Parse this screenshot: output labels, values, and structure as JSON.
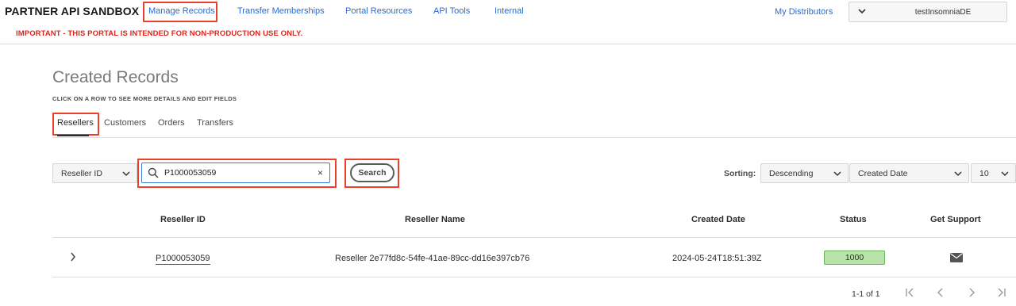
{
  "app": {
    "brand": "PARTNER API SANDBOX",
    "warning": "IMPORTANT - THIS PORTAL IS INTENDED FOR NON-PRODUCTION USE ONLY."
  },
  "nav": {
    "items": [
      "Manage Records",
      "Transfer Memberships",
      "Portal Resources",
      "API Tools",
      "Internal"
    ],
    "active": "Manage Records",
    "distributors": "My Distributors",
    "user": "testInsomniaDE"
  },
  "page": {
    "title": "Created Records",
    "subtitle": "CLICK ON A ROW TO SEE MORE DETAILS AND EDIT FIELDS"
  },
  "tabs": {
    "items": [
      "Resellers",
      "Customers",
      "Orders",
      "Transfers"
    ],
    "active": "Resellers"
  },
  "filters": {
    "field": "Reseller ID",
    "search_value": "P1000053059",
    "search_button": "Search",
    "sorting_label": "Sorting:",
    "sort_order": "Descending",
    "sort_by": "Created Date",
    "page_size": "10"
  },
  "table": {
    "columns": [
      "Reseller ID",
      "Reseller Name",
      "Created Date",
      "Status",
      "Get Support"
    ],
    "rows": [
      {
        "reseller_id": "P1000053059",
        "reseller_name": "Reseller 2e77fd8c-54fe-41ae-89cc-dd16e397cb76",
        "created_date": "2024-05-24T18:51:39Z",
        "status": "1000",
        "support_icon": "mail-icon"
      }
    ]
  },
  "pagination": {
    "range": "1-1 of 1"
  },
  "colors": {
    "link": "#2b6bd0",
    "warning": "#e3231a",
    "highlight": "#e8402a",
    "status_bg": "#b8e3a8"
  }
}
